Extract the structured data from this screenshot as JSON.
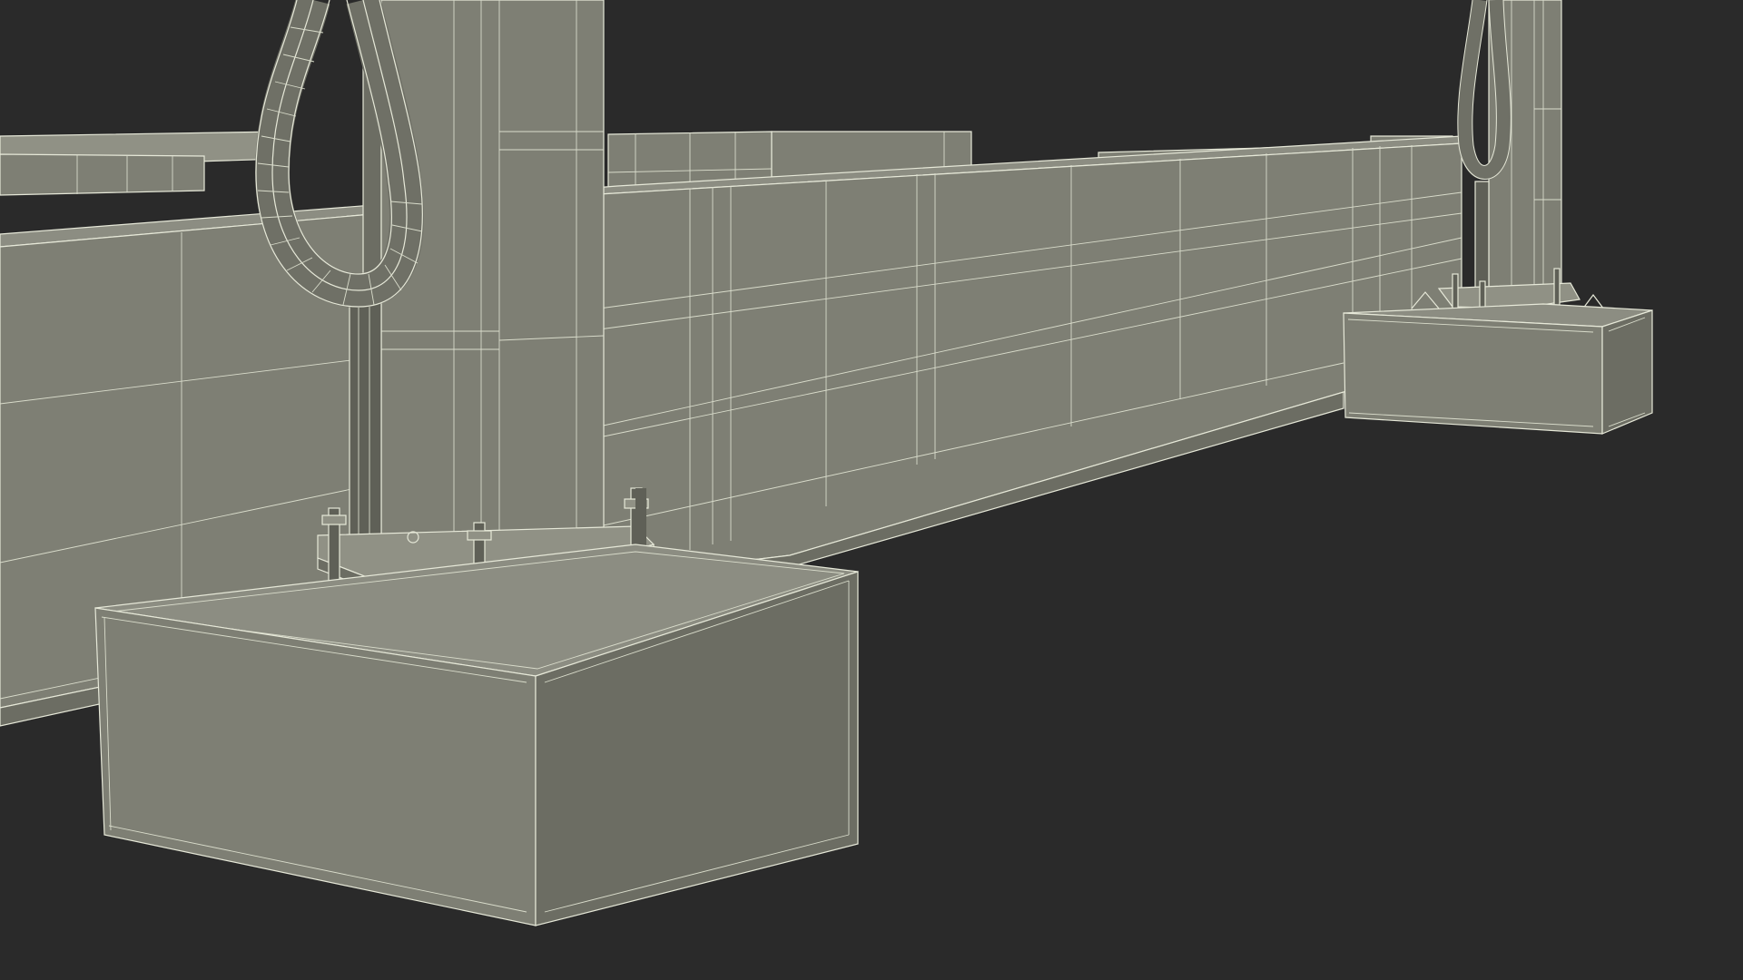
{
  "scene": {
    "background_color": "#2a2a2a",
    "model_face_color": "#7e7f74",
    "wireframe_color": "#e6e8d8"
  }
}
